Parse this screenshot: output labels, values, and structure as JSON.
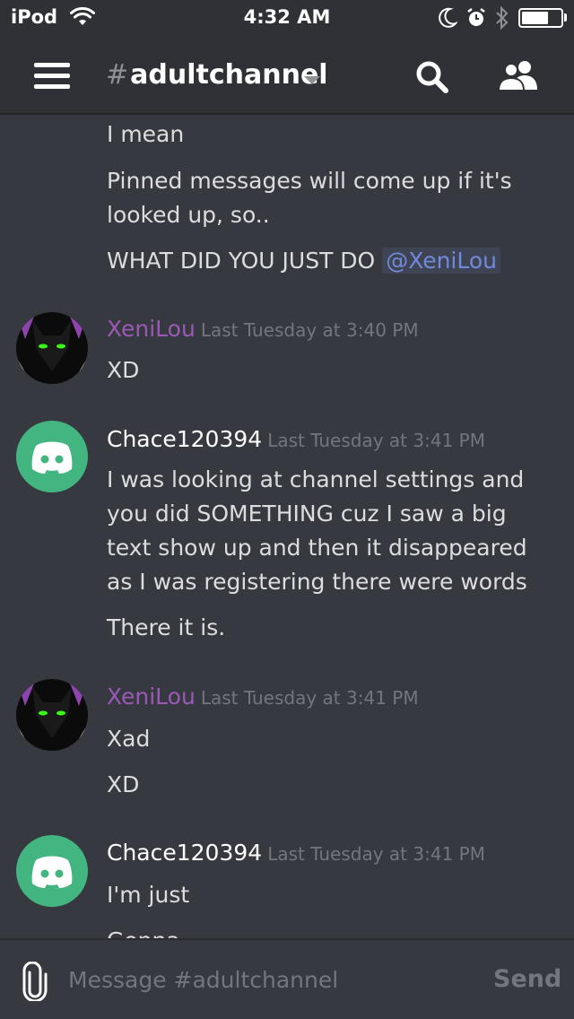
{
  "status_bar": {
    "carrier": "iPod",
    "time": "4:32 AM",
    "battery_level": 0.7,
    "icons": [
      "wifi-icon",
      "moon-icon",
      "alarm-icon",
      "bluetooth-icon",
      "battery-icon"
    ]
  },
  "header": {
    "hash": "#",
    "channel_name": "adultchannel",
    "icons": [
      "hamburger-icon",
      "chevron-down-icon",
      "search-icon",
      "members-icon"
    ]
  },
  "messages": {
    "continuation": {
      "lines": [
        "I mean",
        "Pinned messages will come up if it's",
        "looked up, so..",
        "WHAT DID YOU JUST DO"
      ],
      "mention": "@XeniLou"
    },
    "groups": [
      {
        "username": "XeniLou",
        "timestamp": "Last Tuesday at 3:40 PM",
        "lines": [
          "XD"
        ]
      },
      {
        "username": "Chace120394",
        "timestamp": "Last Tuesday at 3:41 PM",
        "lines": [
          "I was looking at channel settings and",
          "you did SOMETHING cuz I saw a big",
          "text show up and then it disappeared",
          "as I was registering there were words",
          "There it is."
        ]
      },
      {
        "username": "XeniLou",
        "timestamp": "Last Tuesday at 3:41 PM",
        "lines": [
          "Xad",
          "XD"
        ]
      },
      {
        "username": "Chace120394",
        "timestamp": "Last Tuesday at 3:41 PM",
        "lines": [
          "I'm just",
          "Gonna"
        ]
      }
    ]
  },
  "composer": {
    "placeholder": "Message #adultchannel",
    "send_label": "Send"
  },
  "colors": {
    "background": "#36393f",
    "header": "#2f3136",
    "xenilou_name": "#9b59b6",
    "mention_text": "#7289da",
    "discord_avatar": "#43b581",
    "timestamp": "#72767d"
  }
}
